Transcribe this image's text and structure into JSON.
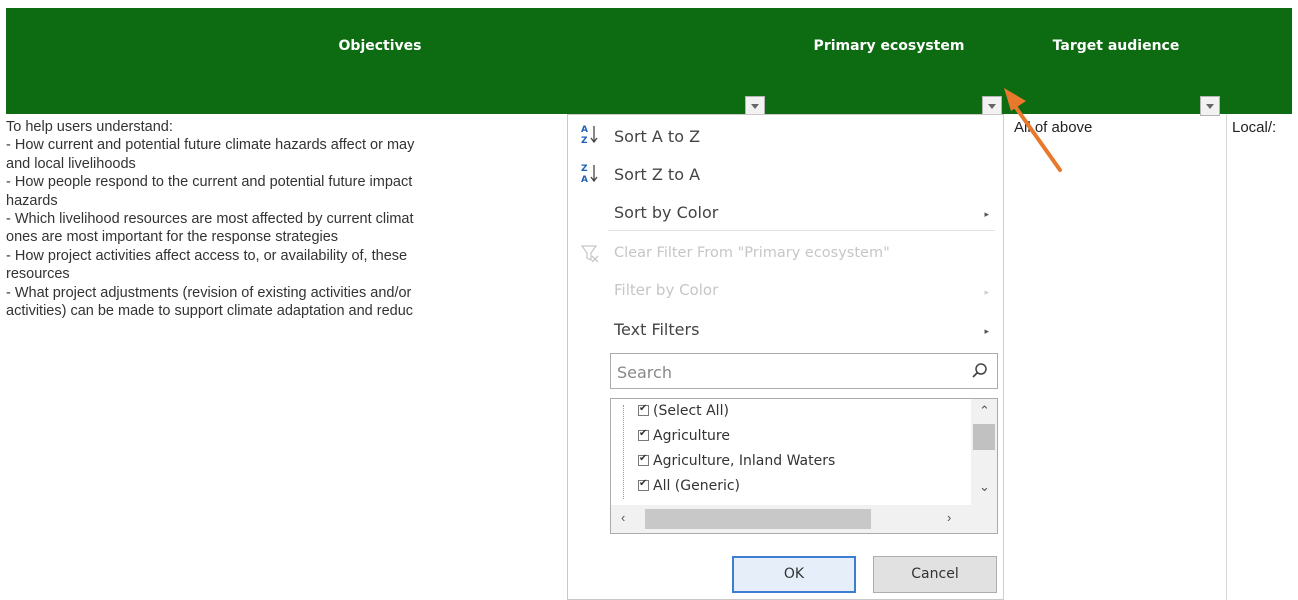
{
  "header": {
    "columns": [
      {
        "label": "Objectives"
      },
      {
        "label": "Primary ecosystem"
      },
      {
        "label": "Target audience"
      }
    ],
    "background_color": "#0d6b12"
  },
  "sheet": {
    "objectives_text": "To help users understand:\n- How current and potential future climate hazards affect or may\nand local livelihoods\n- How people respond to the current and potential future impact\nhazards\n- Which livelihood resources are most affected by current climat\nones are most important for the response strategies\n- How project activities affect access to, or availability of, these\nresources\n- What project adjustments (revision of existing activities and/or\nactivities) can be made to support climate adaptation and reduc",
    "target_audience_value": "All of above",
    "next_column_value": "Local/:"
  },
  "filter_menu": {
    "sort_az": "Sort A to Z",
    "sort_za": "Sort Z to A",
    "sort_by_color": "Sort by Color",
    "clear_filter": "Clear Filter From \"Primary ecosystem\"",
    "filter_by_color": "Filter by Color",
    "text_filters": "Text Filters",
    "search_placeholder": "Search",
    "items": [
      {
        "label": "(Select All)",
        "checked": true
      },
      {
        "label": "Agriculture",
        "checked": true
      },
      {
        "label": "Agriculture, Inland Waters",
        "checked": true
      },
      {
        "label": "All (Generic)",
        "checked": true
      }
    ],
    "ok_label": "OK",
    "cancel_label": "Cancel"
  },
  "icons": {
    "sort_az": "sort-ascending-icon",
    "sort_za": "sort-descending-icon",
    "clear_filter": "clear-filter-icon",
    "search": "search-icon",
    "submenu": "chevron-right-icon",
    "annotation": "arrow-annotation-icon"
  },
  "colors": {
    "header_green": "#0d6b12",
    "arrow_orange": "#e8782b",
    "ok_border": "#3c7fd1"
  }
}
